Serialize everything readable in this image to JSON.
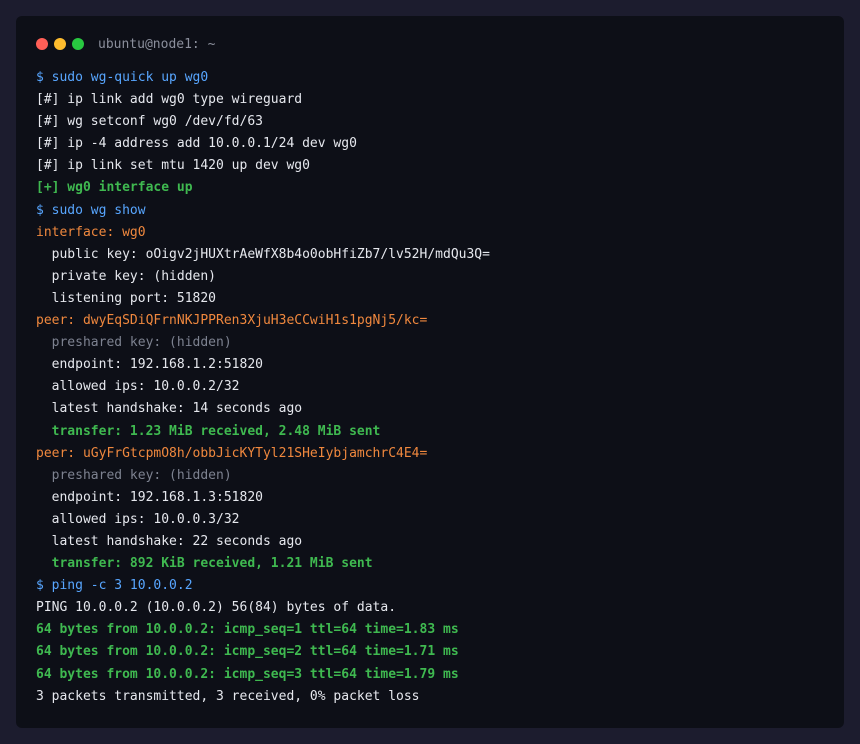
{
  "window": {
    "title": "ubuntu@node1: ~",
    "controls": {
      "close_color": "#ff5f57",
      "minimize_color": "#febc2e",
      "maximize_color": "#28c840"
    }
  },
  "colors": {
    "background": "#0d0f17",
    "command": "#58a6ff",
    "success": "#3fb950",
    "section": "#f0883e",
    "dim": "#7d8290",
    "text": "#e6e8ee"
  },
  "lines": [
    {
      "text": "$ sudo wg-quick up wg0",
      "style": "cmd"
    },
    {
      "text": "[#] ip link add wg0 type wireguard",
      "style": "out"
    },
    {
      "text": "[#] wg setconf wg0 /dev/fd/63",
      "style": "out"
    },
    {
      "text": "[#] ip -4 address add 10.0.0.1/24 dev wg0",
      "style": "out"
    },
    {
      "text": "[#] ip link set mtu 1420 up dev wg0",
      "style": "out"
    },
    {
      "text": "[+] wg0 interface up",
      "style": "ok"
    },
    {
      "text": "$ sudo wg show",
      "style": "cmd"
    },
    {
      "text": "interface: wg0",
      "style": "iface"
    },
    {
      "text": "  public key: oOigv2jHUXtrAeWfX8b4o0obHfiZb7/lv52H/mdQu3Q=",
      "style": "out"
    },
    {
      "text": "  private key: (hidden)",
      "style": "out"
    },
    {
      "text": "  listening port: 51820",
      "style": "out"
    },
    {
      "text": "peer: dwyEqSDiQFrnNKJPPRen3XjuH3eCCwiH1s1pgNj5/kc=",
      "style": "iface"
    },
    {
      "text": "  preshared key: (hidden)",
      "style": "dim"
    },
    {
      "text": "  endpoint: 192.168.1.2:51820",
      "style": "out"
    },
    {
      "text": "  allowed ips: 10.0.0.2/32",
      "style": "out"
    },
    {
      "text": "  latest handshake: 14 seconds ago",
      "style": "out"
    },
    {
      "text": "  transfer: 1.23 MiB received, 2.48 MiB sent",
      "style": "ok"
    },
    {
      "text": "peer: uGyFrGtcpmO8h/obbJicKYTyl21SHeIybjamchrC4E4=",
      "style": "iface"
    },
    {
      "text": "  preshared key: (hidden)",
      "style": "dim"
    },
    {
      "text": "  endpoint: 192.168.1.3:51820",
      "style": "out"
    },
    {
      "text": "  allowed ips: 10.0.0.3/32",
      "style": "out"
    },
    {
      "text": "  latest handshake: 22 seconds ago",
      "style": "out"
    },
    {
      "text": "  transfer: 892 KiB received, 1.21 MiB sent",
      "style": "ok"
    },
    {
      "text": "$ ping -c 3 10.0.0.2",
      "style": "cmd"
    },
    {
      "text": "PING 10.0.0.2 (10.0.0.2) 56(84) bytes of data.",
      "style": "out"
    },
    {
      "text": "64 bytes from 10.0.0.2: icmp_seq=1 ttl=64 time=1.83 ms",
      "style": "ok"
    },
    {
      "text": "64 bytes from 10.0.0.2: icmp_seq=2 ttl=64 time=1.71 ms",
      "style": "ok"
    },
    {
      "text": "64 bytes from 10.0.0.2: icmp_seq=3 ttl=64 time=1.79 ms",
      "style": "ok"
    },
    {
      "text": "3 packets transmitted, 3 received, 0% packet loss",
      "style": "out"
    }
  ]
}
